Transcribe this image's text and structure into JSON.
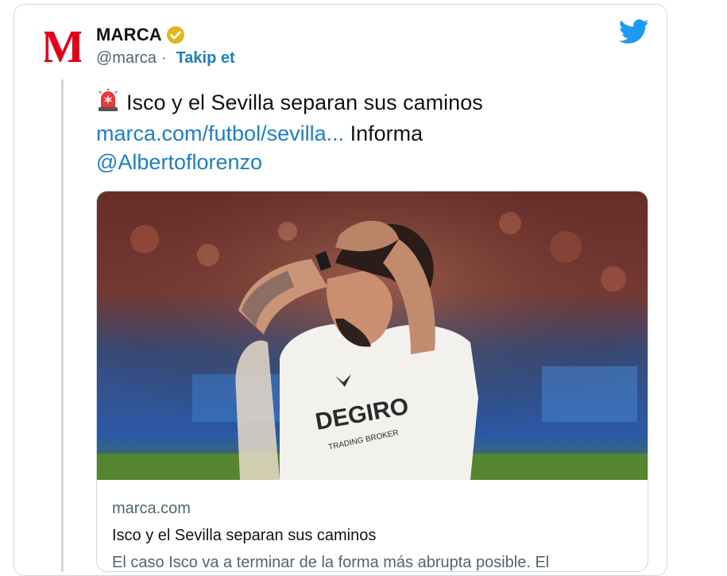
{
  "header": {
    "account_name": "MARCA",
    "handle": "@marca",
    "separator": "·",
    "follow_label": "Takip et",
    "logo_letter": "M"
  },
  "tweet": {
    "emoji_icon": "police-siren-icon",
    "text_line1": "Isco y el Sevilla separan sus caminos",
    "link_text": "marca.com/futbol/sevilla...",
    "text_after_link": " Informa",
    "mention": "@Albertoflorenzo"
  },
  "link_card": {
    "domain": "marca.com",
    "title": "Isco y el Sevilla separan sus caminos",
    "description": "El caso Isco va a terminar de la forma más abrupta posible. El",
    "jersey_sponsor": "DEGIRO",
    "jersey_subtext": "TRADING BROKER"
  },
  "colors": {
    "link": "#1d7fc4",
    "twitter_blue": "#1d9bf0",
    "marca_red": "#e2001a",
    "verified_gold": "#e2b719"
  }
}
